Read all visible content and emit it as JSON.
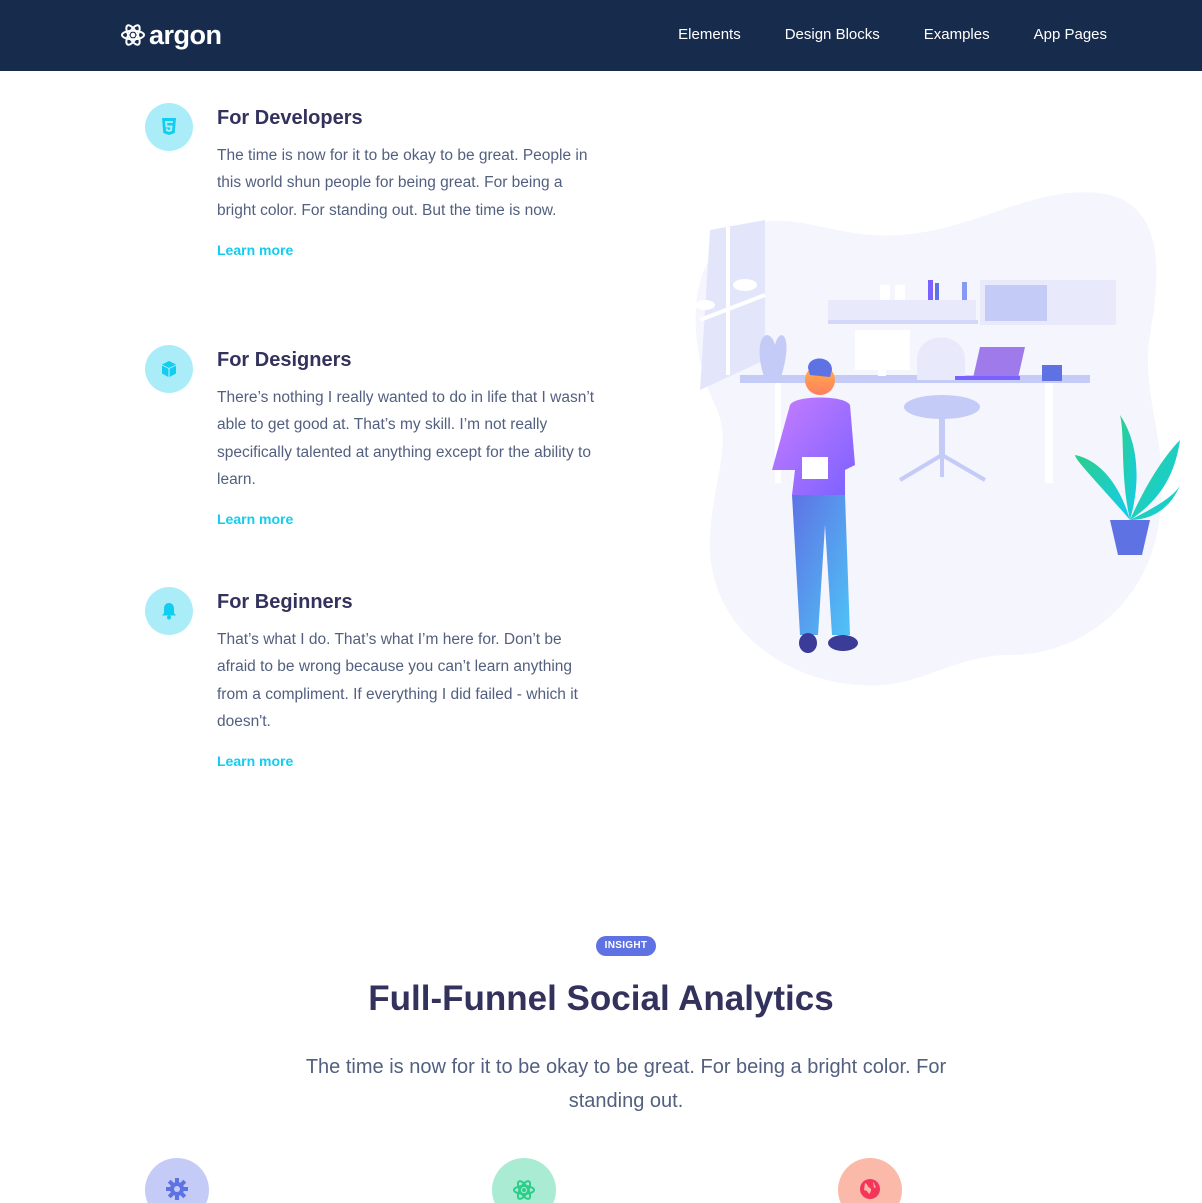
{
  "nav": {
    "brand": "argon",
    "links": [
      "Elements",
      "Design Blocks",
      "Examples",
      "App Pages"
    ]
  },
  "features": [
    {
      "icon": "html5-icon",
      "title": "For Developers",
      "text": "The time is now for it to be okay to be great. People in this world shun people for being great. For being a bright color. For standing out. But the time is now.",
      "link": "Learn more"
    },
    {
      "icon": "cube-icon",
      "title": "For Designers",
      "text": "There’s nothing I really wanted to do in life that I wasn’t able to get good at. That’s my skill. I’m not really specifically talented at anything except for the ability to learn.",
      "link": "Learn more"
    },
    {
      "icon": "bell-icon",
      "title": "For Beginners",
      "text": "That’s what I do. That’s what I’m here for. Don’t be afraid to be wrong because you can’t learn anything from a compliment. If everything I did failed - which it doesn't.",
      "link": "Learn more"
    }
  ],
  "insight": {
    "badge": "INSIGHT",
    "title": "Full-Funnel Social Analytics",
    "lead": "The time is now for it to be okay to be great. For being a bright color. For standing out."
  },
  "bottom_icons": [
    {
      "icon": "settings-gear-icon",
      "bg": "#c5cbf7",
      "fg": "#5e72e4"
    },
    {
      "icon": "atom-icon",
      "bg": "#a9ecd3",
      "fg": "#2dce89"
    },
    {
      "icon": "world-icon",
      "bg": "#fbb9a9",
      "fg": "#f5365c"
    }
  ],
  "colors": {
    "navbar": "#172b4d",
    "primary": "#5e72e4",
    "info": "#11cdef",
    "text": "#32325d",
    "muted": "#525f7f"
  }
}
